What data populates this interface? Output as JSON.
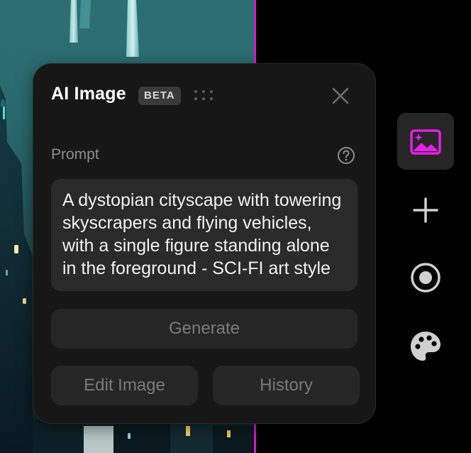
{
  "panel": {
    "title": "AI Image",
    "badge": "BETA",
    "prompt_label": "Prompt",
    "prompt_value": "A dystopian cityscape with towering skyscrapers and flying vehicles, with a single figure standing alone in the foreground - SCI-FI art style",
    "buttons": {
      "generate": "Generate",
      "edit_image": "Edit Image",
      "history": "History"
    },
    "icons": {
      "drag": "drag-handle-icon",
      "close": "close-icon",
      "help": "help-icon"
    }
  },
  "toolbar": {
    "items": [
      {
        "name": "ai-image",
        "icon": "image-sparkle-icon",
        "active": true
      },
      {
        "name": "add",
        "icon": "plus-icon",
        "active": false
      },
      {
        "name": "record",
        "icon": "record-icon",
        "active": false
      },
      {
        "name": "palette",
        "icon": "palette-icon",
        "active": false
      }
    ]
  },
  "colors": {
    "accent": "#e61ee6",
    "panel_bg": "#171717",
    "field_bg": "#2a2a2a",
    "button_bg": "#262626",
    "muted_text": "#8e8e8e"
  }
}
